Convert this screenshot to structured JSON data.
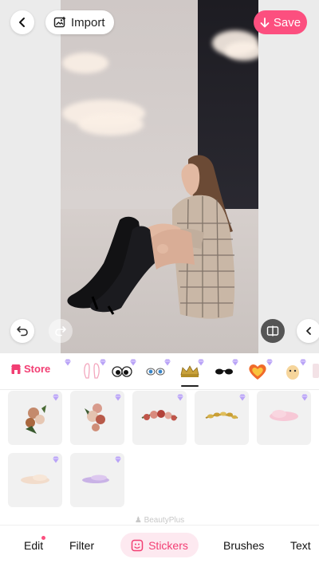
{
  "topbar": {
    "import_label": "Import",
    "save_label": "Save"
  },
  "panel": {
    "store_label": "Store",
    "brand": "BeautyPlus",
    "categories": [
      "bunny-ears",
      "cartoon-eyes",
      "blue-eyes",
      "gold-crown",
      "sunglasses",
      "heart-badge",
      "egg-character"
    ],
    "selected_category": "gold-crown",
    "stickers": [
      "flower-bouquet",
      "rose-cluster",
      "rose-crown",
      "gold-leaf-crown",
      "pink-cloud",
      "peach-cloud",
      "purple-cloud"
    ]
  },
  "nav": {
    "items": [
      {
        "label": "Edit"
      },
      {
        "label": "Filter"
      },
      {
        "label": "Stickers"
      },
      {
        "label": "Brushes"
      },
      {
        "label": "Text"
      }
    ],
    "active": "Stickers"
  },
  "colors": {
    "accent": "#fc4f7f",
    "accent_text": "#f23e73",
    "active_bg": "#fde9f0"
  }
}
